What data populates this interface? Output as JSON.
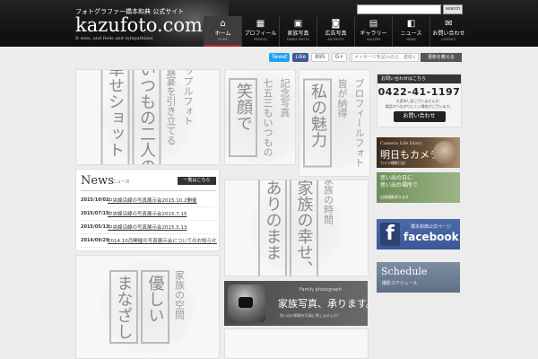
{
  "header": {
    "site_sub": "フォトグラファー橋本和典 公式サイト",
    "logo": "kazufoto.com",
    "tagline": "It sees, and feels and sympathizes",
    "search_button": "search"
  },
  "nav": [
    {
      "label": "ホーム",
      "sub": "HOME",
      "icon": "home-icon",
      "active": true
    },
    {
      "label": "プロフィール",
      "sub": "PROFILE",
      "icon": "profile-icon",
      "active": false
    },
    {
      "label": "家族写真",
      "sub": "FAMILY PHOTO",
      "icon": "family-photo-icon",
      "active": false
    },
    {
      "label": "広告写真",
      "sub": "AD PHOTO",
      "icon": "ad-photo-icon",
      "active": false
    },
    {
      "label": "ギャラリー",
      "sub": "GALLERY",
      "icon": "gallery-icon",
      "active": false
    },
    {
      "label": "ニュース",
      "sub": "NEWS",
      "icon": "news-icon",
      "active": false
    },
    {
      "label": "お問い合わせ",
      "sub": "CONTACT",
      "icon": "mail-icon",
      "active": false
    }
  ],
  "social": {
    "tweet": "Tweet",
    "like": "Like",
    "like_count": "895",
    "gplus": "G+",
    "gplus_count": "0",
    "mail_placeholder": "メッセージを記入の上、送信ください。",
    "mail_button": "更新を教える"
  },
  "tiles": {
    "couple": {
      "small": [
        "カップルフォト",
        "披露宴を引き立てる"
      ],
      "big": [
        "いつもの二人の",
        "幸せショット"
      ]
    },
    "family_sum": {
      "small": [
        "記念写真",
        "七五三もいつもの"
      ],
      "big": [
        "笑顔で"
      ]
    },
    "profile": {
      "small": [
        "プロフィールフォト",
        "皆が納得"
      ],
      "big": [
        "私の魅力"
      ]
    },
    "family_time": {
      "small": [
        "家族の時間"
      ],
      "big": [
        "家族の幸せ、",
        "ありのまま"
      ]
    },
    "space": {
      "small": [
        "家族の空間"
      ],
      "big": [
        "優しい",
        "まなざし"
      ]
    }
  },
  "news": {
    "title": "News",
    "subtitle": "ニュース",
    "more": "一覧はこちら",
    "items": [
      {
        "date": "2015/10/02",
        "text": "中央線沿線の写真展示会2015.10.2開催"
      },
      {
        "date": "2015/07/15",
        "text": "中央線沿線の写真展示会2015.7.15"
      },
      {
        "date": "2015/05/13",
        "text": "中央線沿線の写真展示会2015.5.13"
      },
      {
        "date": "2014/09/29",
        "text": "2014.10月開催の写真展示会についてのお知らせ..."
      }
    ]
  },
  "family_banner": {
    "small": "Family photograph",
    "big": "家族写真、承ります。",
    "note": "思い出の瞬間を写真に残しませんか？"
  },
  "contact": {
    "head": "お問い合わせはこちら",
    "phone": "0422-41-1197",
    "note_1": "大変申し訳ございませんが、",
    "note_2": "電話がつながりにくい場合がございます。",
    "button": "お問い合わせ"
  },
  "banners": {
    "camera": {
      "label": "Camera Life Diary",
      "title": "明日もカメラ",
      "sub": "カメラ撮影日記"
    },
    "green": {
      "line1": "思い出の日に",
      "line2": "思い出の場所で",
      "sub": "出張撮影承ります"
    },
    "facebook": {
      "label": "橋本和典公式ページ",
      "title": "facebook"
    },
    "schedule": {
      "title": "Schedule",
      "sub": "撮影スケジュール"
    }
  }
}
